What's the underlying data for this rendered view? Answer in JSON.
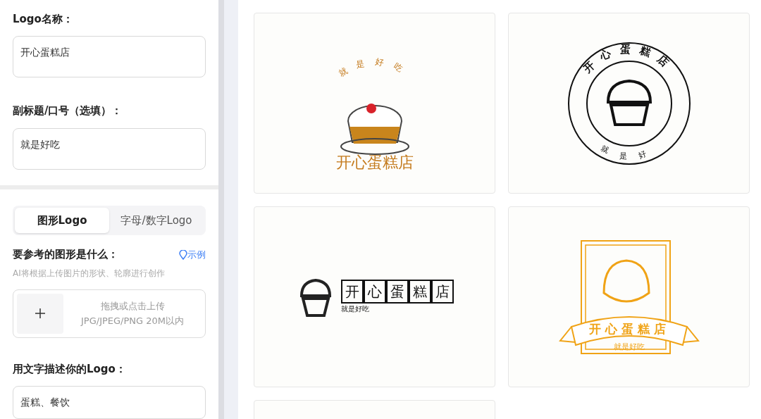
{
  "form": {
    "name_label": "Logo名称：",
    "name_value": "开心蛋糕店",
    "slogan_label": "副标题/口号（选填）：",
    "slogan_value": "就是好吃",
    "tabs": [
      {
        "label": "图形Logo",
        "selected": true
      },
      {
        "label": "字母/数字Logo",
        "selected": false
      }
    ],
    "shape_label": "要参考的图形是什么：",
    "example_link": "示例",
    "shape_hint": "AI将根据上传图片的形状、轮廓进行创作",
    "upload": {
      "line_1": "拖拽或点击上传",
      "line_2": "JPG/JPEG/PNG 20M以内"
    },
    "describe_label": "用文字描述你的Logo：",
    "describe_value": "蛋糕、餐饮"
  },
  "results": [
    {
      "kind": "arc",
      "name": "开心蛋糕店",
      "slogan": "就是好吃"
    },
    {
      "kind": "badge",
      "name": "开心蛋糕店",
      "slogan": "就是好"
    },
    {
      "kind": "boxed",
      "name": "开心蛋糕店",
      "slogan": "就是好吃"
    },
    {
      "kind": "ribbon",
      "name": "开心蛋糕店",
      "slogan": "就是好吃"
    },
    {
      "kind": "blank"
    }
  ]
}
